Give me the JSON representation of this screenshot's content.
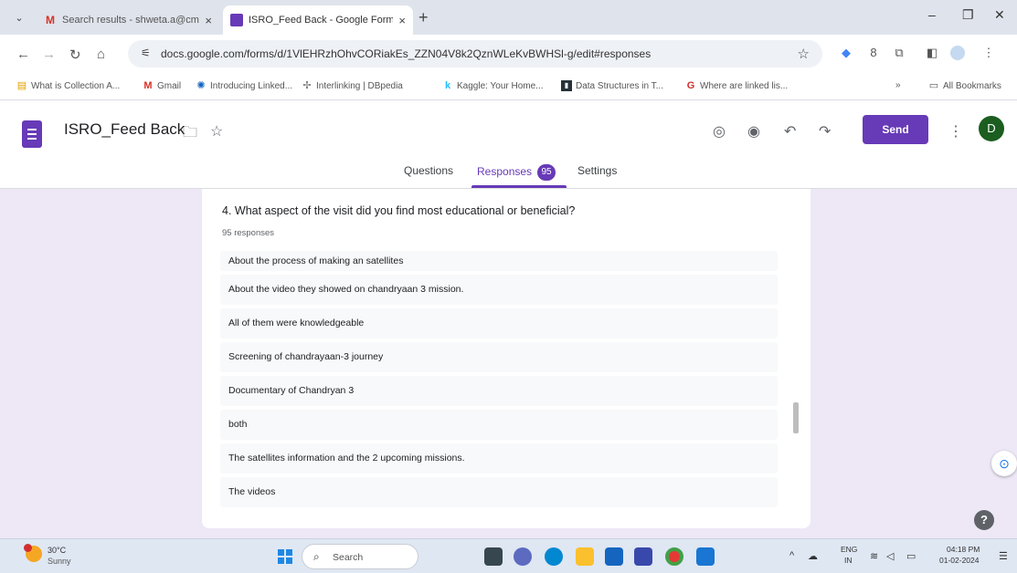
{
  "browser": {
    "tabs": [
      {
        "title": "Search results - shweta.a@cm",
        "icon": "gmail-icon",
        "active": false
      },
      {
        "title": "ISRO_Feed Back - Google Form",
        "icon": "google-forms-icon",
        "active": true
      }
    ],
    "url": "docs.google.com/forms/d/1VlEHRzhOhvCORiakEs_ZZN04V8k2QznWLeKvBWHSl-g/edit#responses",
    "bookmarks": [
      {
        "label": "What is Collection A...",
        "icon": "page-icon"
      },
      {
        "label": "Gmail",
        "icon": "gmail-icon"
      },
      {
        "label": "Introducing Linked...",
        "icon": "linked-data-icon"
      },
      {
        "label": "Interlinking | DBpedia",
        "icon": "dbpedia-icon"
      },
      {
        "label": "Kaggle: Your Home...",
        "icon": "kaggle-icon"
      },
      {
        "label": "Data Structures in T...",
        "icon": "book-icon"
      },
      {
        "label": "Where are linked lis...",
        "icon": "geeks-icon"
      }
    ],
    "all_bookmarks_label": "All Bookmarks",
    "more_bookmarks": "»"
  },
  "form": {
    "title": "ISRO_Feed Back",
    "send_label": "Send",
    "avatar_initial": "D",
    "tabs": {
      "questions": "Questions",
      "responses": "Responses",
      "responses_count": "95",
      "settings": "Settings"
    },
    "accent": "#673ab7"
  },
  "question": {
    "title": "4. What aspect of the visit did you find most educational or beneficial?",
    "response_count": "95 responses",
    "responses": [
      "About the process of making an satellites",
      "About the video they showed on chandryaan 3 mission.",
      "All of them were knowledgeable",
      "Screening of chandrayaan-3 journey",
      "Documentary of Chandryan 3",
      "both",
      "The satellites information and the 2 upcoming missions.",
      "The videos"
    ]
  },
  "taskbar": {
    "weather_temp": "30°C",
    "weather_cond": "Sunny",
    "search_placeholder": "Search",
    "lang_top": "ENG",
    "lang_bottom": "IN",
    "time": "04:18 PM",
    "date": "01-02-2024"
  }
}
